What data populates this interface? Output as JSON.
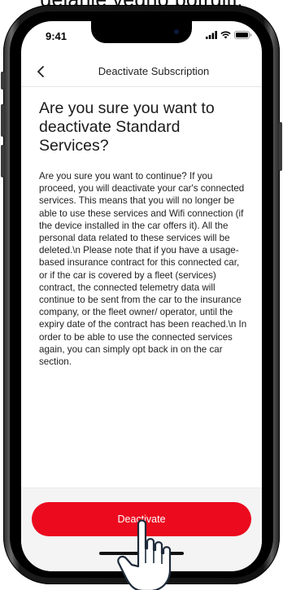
{
  "caption": "dejanje vedno potrditi.",
  "status_bar": {
    "time": "9:41"
  },
  "nav": {
    "title": "Deactivate Subscription"
  },
  "content": {
    "heading": "Are you sure you want to deactivate Standard Services?",
    "body": "Are you sure you want to continue? If you proceed, you will deactivate your car's connected services. This means that you will no longer be able to use these services and Wifi connection (if the device installed in the car offers it). All the personal data related to these services will be deleted.\\n Please note that if you have a usage-based insurance contract for this connected car, or if the car is covered by a fleet (services) contract, the connected telemetry data will continue to be sent from the car to the insurance company, or the fleet owner/ operator, until the expiry date of the contract has been reached.\\n In order to be able to use the connected services again, you can simply opt back in on the car section."
  },
  "actions": {
    "deactivate_label": "Deactivate"
  },
  "colors": {
    "accent": "#eb0a1e"
  },
  "icons": {
    "back": "chevron-left-icon",
    "signal": "signal-icon",
    "wifi": "wifi-icon",
    "battery": "battery-icon",
    "pointer": "hand-pointer-icon"
  }
}
